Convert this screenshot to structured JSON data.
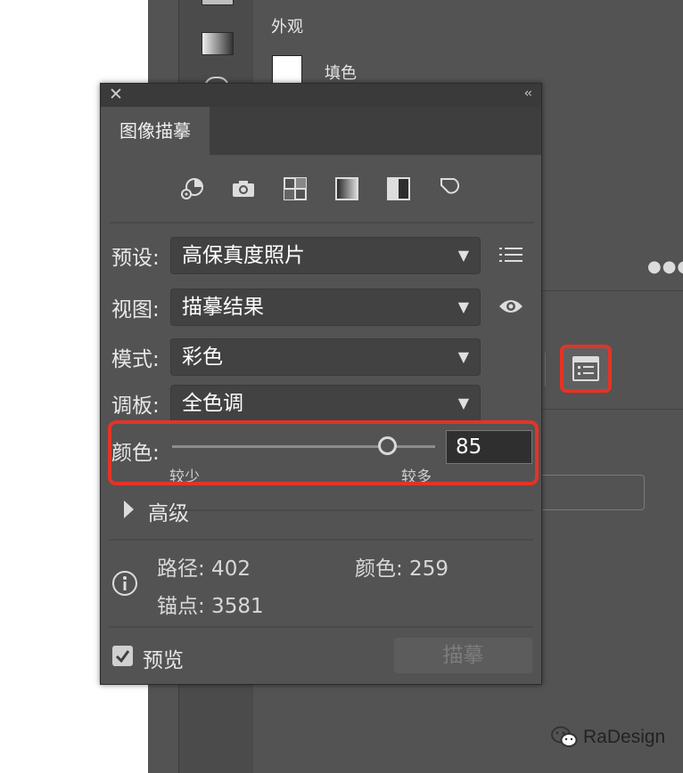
{
  "background": {
    "props_section_title": "外观",
    "fill_label": "填色"
  },
  "panel": {
    "tab_label": "图像描摹",
    "preset_icons": [
      "auto-color-icon",
      "camera-icon",
      "low-color-icon",
      "grayscale-icon",
      "black-white-icon",
      "outline-icon"
    ],
    "preset_label": "预设:",
    "preset_value": "高保真度照片",
    "view_label": "视图:",
    "view_value": "描摹结果",
    "mode_label": "模式:",
    "mode_value": "彩色",
    "palette_label": "调板:",
    "palette_value": "全色调",
    "colors_label": "颜色:",
    "colors_value": "85",
    "colors_fraction": 0.82,
    "slider_min_label": "较少",
    "slider_max_label": "较多",
    "advanced_label": "高级",
    "stats": {
      "paths": "路径: 402",
      "colors": "颜色: 259",
      "anchors": "锚点: 3581"
    },
    "preview_label": "预览",
    "trace_button": "描摹"
  },
  "watermark": "RaDesign",
  "colors": {
    "highlight": "#e43327",
    "panel_bg": "#535353"
  }
}
